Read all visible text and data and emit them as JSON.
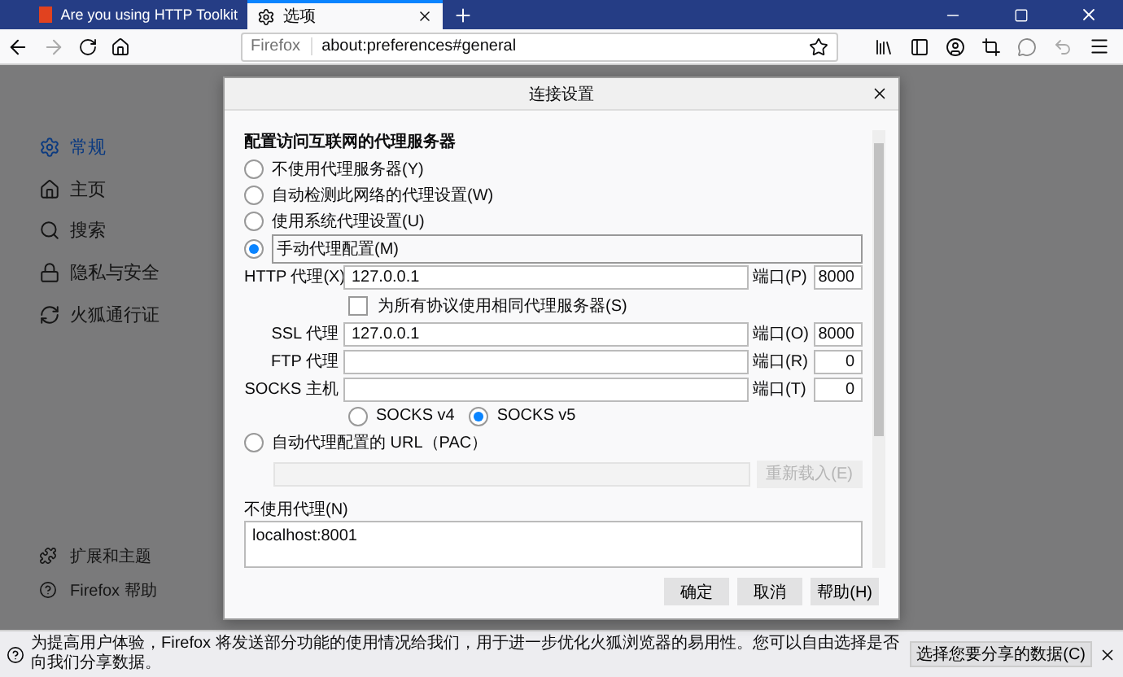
{
  "tabs": [
    {
      "title": "Are you using HTTP Toolkit",
      "selected": false
    },
    {
      "title": "选项",
      "selected": true
    }
  ],
  "address_bar": {
    "identity": "Firefox",
    "url": "about:preferences#general"
  },
  "sidebar": {
    "items": [
      {
        "label": "常规",
        "selected": true
      },
      {
        "label": "主页",
        "selected": false
      },
      {
        "label": "搜索",
        "selected": false
      },
      {
        "label": "隐私与安全",
        "selected": false
      },
      {
        "label": "火狐通行证",
        "selected": false
      }
    ],
    "footer": [
      "扩展和主题",
      "Firefox 帮助"
    ]
  },
  "dialog": {
    "title": "连接设置",
    "heading": "配置访问互联网的代理服务器",
    "modes": [
      {
        "label": "不使用代理服务器(Y)",
        "selected": false
      },
      {
        "label": "自动检测此网络的代理设置(W)",
        "selected": false
      },
      {
        "label": "使用系统代理设置(U)",
        "selected": false
      },
      {
        "label": "手动代理配置(M)",
        "selected": true
      }
    ],
    "proxies": [
      {
        "label": "HTTP 代理(X)",
        "value": "127.0.0.1",
        "port_label": "端口(P)",
        "port": "8000"
      },
      {
        "label": "SSL 代理",
        "value": "127.0.0.1",
        "port_label": "端口(O)",
        "port": "8000"
      },
      {
        "label": "FTP 代理",
        "port_label": "端口(R)",
        "port": "0"
      },
      {
        "label": "SOCKS 主机",
        "port_label": "端口(T)",
        "port": "0"
      }
    ],
    "share_all": {
      "label": "为所有协议使用相同代理服务器(S)",
      "checked": false
    },
    "socks_versions": [
      {
        "label": "SOCKS v4",
        "selected": false
      },
      {
        "label": "SOCKS v5",
        "selected": true
      }
    ],
    "pac": {
      "label": "自动代理配置的 URL（PAC）",
      "selected": false,
      "reload_button": "重新载入(E)"
    },
    "no_proxy": {
      "label": "不使用代理(N)",
      "value": "localhost:8001"
    },
    "buttons": [
      "确定",
      "取消",
      "帮助(H)"
    ]
  },
  "notification": {
    "text": "为提高用户体验，Firefox 将发送部分功能的使用情况给我们，用于进一步优化火狐浏览器的易用性。您可以自由选择是否向我们分享数据。",
    "button": "选择您要分享的数据(C)"
  }
}
